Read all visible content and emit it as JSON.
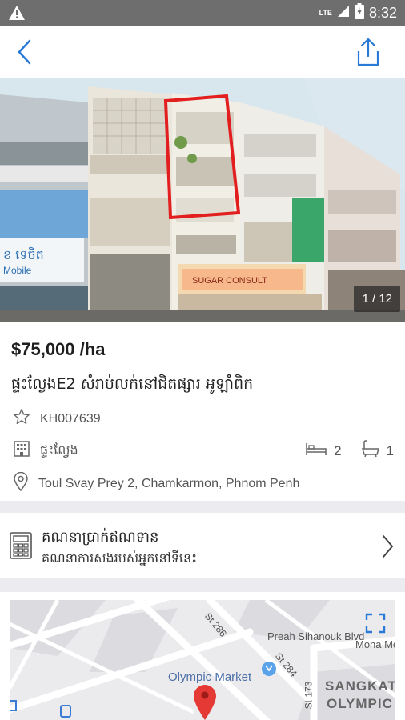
{
  "status_bar": {
    "network": "LTE",
    "time": "8:32"
  },
  "gallery": {
    "counter": "1 / 12"
  },
  "listing": {
    "price": "$75,000 /ha",
    "title": "ផ្ទះល្វែងE2 សំរាប់លក់នៅជិតផ្សារ អូឡាំពិក",
    "code": "KH007639",
    "property_type": "ផ្ទះល្វែង",
    "bedrooms": "2",
    "bathrooms": "1",
    "address": "Toul Svay Prey 2, Chamkarmon, Phnom Penh"
  },
  "calculator": {
    "title": "គណនាប្រាក់ឥណទាន",
    "subtitle": "គណនាការសងរបស់អ្នកនៅទីនេះ"
  },
  "map": {
    "labels": {
      "street_286": "St 286",
      "preah_sihanouk": "Preah Sihanouk Blvd",
      "mona": "Mona Mc",
      "street_284": "St 284",
      "olympic_market": "Olympic Market",
      "street_173": "St 173",
      "sangkat": "SANGKAT",
      "olympic": "OLYMPIC"
    }
  },
  "colors": {
    "accent": "#2979d6",
    "pin": "#e53935",
    "status_bar": "#6e6e6e"
  },
  "icons": {
    "back": "chevron-left-icon",
    "share": "share-icon",
    "code": "star-icon",
    "type": "building-icon",
    "bed": "bed-icon",
    "bath": "bathtub-icon",
    "address": "location-pin-icon",
    "calculator": "calculator-icon",
    "expand": "fullscreen-icon"
  }
}
